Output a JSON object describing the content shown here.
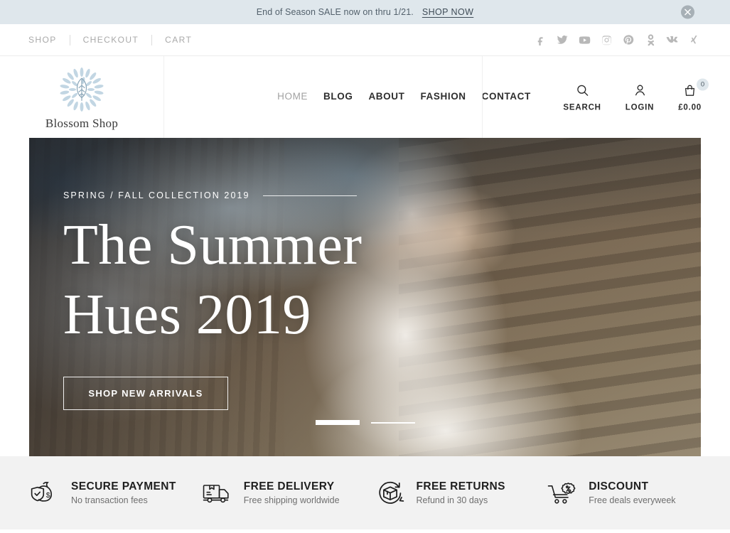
{
  "announcement": {
    "text": "End of Season SALE now on thru 1/21.",
    "link_label": "SHOP NOW",
    "close_icon": "close-circle-icon",
    "background": "#dfe7ec"
  },
  "topbar": {
    "links": [
      {
        "label": "SHOP"
      },
      {
        "label": "CHECKOUT"
      },
      {
        "label": "CART"
      }
    ],
    "social": [
      {
        "name": "facebook-icon"
      },
      {
        "name": "twitter-icon"
      },
      {
        "name": "youtube-icon"
      },
      {
        "name": "instagram-icon"
      },
      {
        "name": "pinterest-icon"
      },
      {
        "name": "odnoklassniki-icon"
      },
      {
        "name": "vk-icon"
      },
      {
        "name": "xing-icon"
      }
    ]
  },
  "header": {
    "brand_name": "Blossom Shop",
    "logo_icon": "blossom-leaf-icon",
    "logo_color": "#bcd2e0",
    "nav": [
      {
        "label": "HOME",
        "active": true
      },
      {
        "label": "BLOG",
        "active": false
      },
      {
        "label": "ABOUT",
        "active": false
      },
      {
        "label": "FASHION",
        "active": false
      },
      {
        "label": "CONTACT",
        "active": false
      }
    ],
    "actions": {
      "search_label": "SEARCH",
      "search_icon": "search-icon",
      "login_label": "LOGIN",
      "login_icon": "user-icon",
      "cart_label": "£0.00",
      "cart_icon": "shopping-bag-icon",
      "cart_count": "0"
    }
  },
  "hero": {
    "eyebrow": "SPRING / FALL COLLECTION 2019",
    "title_line1": "The Summer",
    "title_line2": "Hues 2019",
    "button_label": "SHOP NEW ARRIVALS",
    "slides_total": 2,
    "slide_active": 1
  },
  "features": [
    {
      "icon": "secure-payment-icon",
      "title": "SECURE PAYMENT",
      "subtitle": "No transaction fees"
    },
    {
      "icon": "delivery-truck-icon",
      "title": "FREE DELIVERY",
      "subtitle": "Free shipping worldwide"
    },
    {
      "icon": "returns-box-icon",
      "title": "FREE RETURNS",
      "subtitle": "Refund in 30 days"
    },
    {
      "icon": "discount-cart-icon",
      "title": "DISCOUNT",
      "subtitle": "Free deals everyweek"
    }
  ]
}
